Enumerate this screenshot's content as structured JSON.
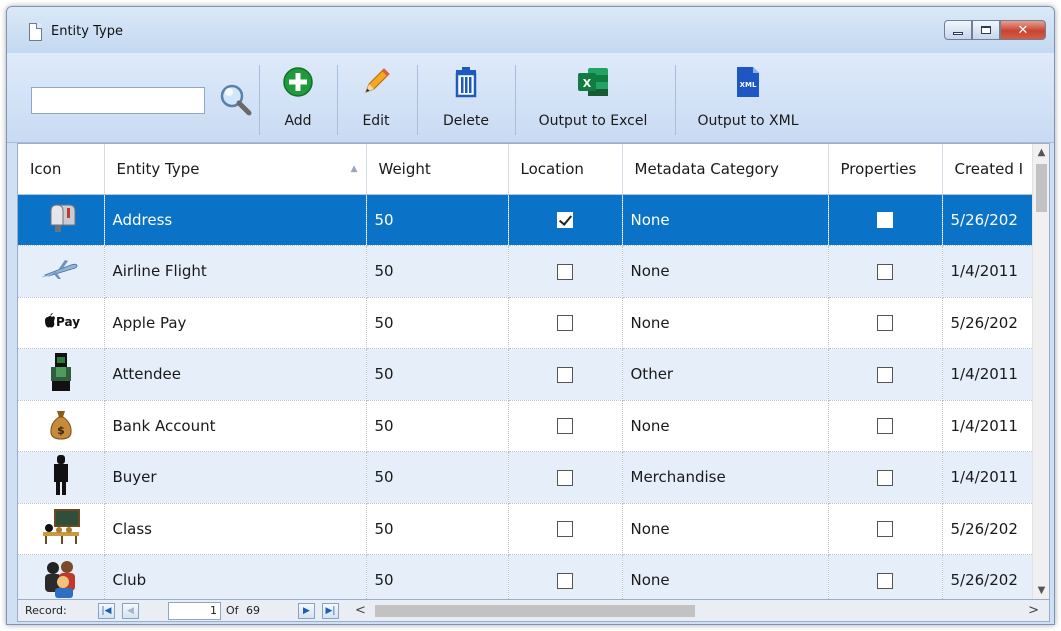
{
  "window": {
    "title": "Entity Type",
    "controls": {
      "minimize": "minimize",
      "maximize": "maximize",
      "close": "✕"
    }
  },
  "toolbar": {
    "search": {
      "value": "",
      "placeholder": ""
    },
    "add_label": "Add",
    "edit_label": "Edit",
    "delete_label": "Delete",
    "excel_label": "Output to Excel",
    "xml_label": "Output to XML",
    "xml_icon_text": "XML",
    "excel_icon_text": "X"
  },
  "grid": {
    "columns": [
      "Icon",
      "Entity Type",
      "Weight",
      "Location",
      "Metadata Category",
      "Properties",
      "Created I"
    ],
    "rows": [
      {
        "icon": "mailbox-icon",
        "entity_type": "Address",
        "weight": "50",
        "location": true,
        "metadata_category": "None",
        "properties": false,
        "created": "5/26/202",
        "selected": true
      },
      {
        "icon": "airplane-icon",
        "entity_type": "Airline Flight",
        "weight": "50",
        "location": false,
        "metadata_category": "None",
        "properties": false,
        "created": "1/4/2011",
        "selected": false
      },
      {
        "icon": "apple-pay-icon",
        "icon_text": "Pay",
        "entity_type": "Apple Pay",
        "weight": "50",
        "location": false,
        "metadata_category": "None",
        "properties": false,
        "created": "5/26/202",
        "selected": false
      },
      {
        "icon": "attendee-icon",
        "entity_type": "Attendee",
        "weight": "50",
        "location": false,
        "metadata_category": "Other",
        "properties": false,
        "created": "1/4/2011",
        "selected": false
      },
      {
        "icon": "money-bag-icon",
        "entity_type": "Bank Account",
        "weight": "50",
        "location": false,
        "metadata_category": "None",
        "properties": false,
        "created": "1/4/2011",
        "selected": false
      },
      {
        "icon": "person-silhouette-icon",
        "entity_type": "Buyer",
        "weight": "50",
        "location": false,
        "metadata_category": "Merchandise",
        "properties": false,
        "created": "1/4/2011",
        "selected": false
      },
      {
        "icon": "classroom-icon",
        "entity_type": "Class",
        "weight": "50",
        "location": false,
        "metadata_category": "None",
        "properties": false,
        "created": "5/26/202",
        "selected": false
      },
      {
        "icon": "group-icon",
        "entity_type": "Club",
        "weight": "50",
        "location": false,
        "metadata_category": "None",
        "properties": false,
        "created": "5/26/202",
        "selected": false
      }
    ]
  },
  "status": {
    "record_label": "Record:",
    "current": "1",
    "of_label": "Of",
    "total": "69"
  },
  "colors": {
    "selection": "#0b73c7",
    "alt_row": "#e6eefa",
    "chrome": "#cfe0f5"
  }
}
